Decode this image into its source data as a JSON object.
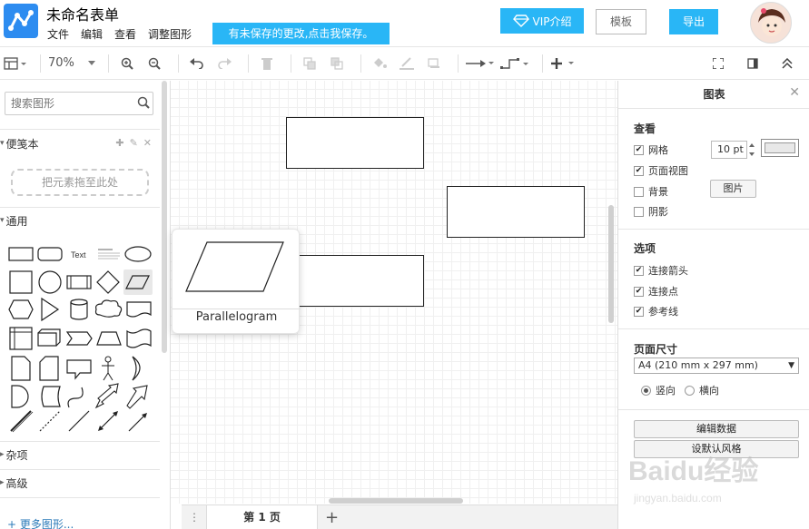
{
  "header": {
    "app_title": "未命名表单",
    "menu": [
      "文件",
      "编辑",
      "查看",
      "调整图形"
    ],
    "unsaved_notice": "有未保存的更改,点击我保存。",
    "vip_label": "VIP介绍",
    "template_label": "模板",
    "export_label": "导出"
  },
  "toolbar": {
    "zoom": "70%"
  },
  "sidebar": {
    "search_placeholder": "搜索图形",
    "scratchpad_title": "便笺本",
    "dropzone_text": "把元素拖至此处",
    "general_title": "通用",
    "misc_title": "杂项",
    "advanced_title": "高级",
    "more_shapes": "+ 更多图形...",
    "shape_text_label": "Text"
  },
  "tooltip": {
    "shape_name": "Parallelogram"
  },
  "pages": {
    "current_tab": "第 1 页"
  },
  "format_panel": {
    "title": "图表",
    "view_section": "查看",
    "grid_label": "网格",
    "grid_size": "10 pt",
    "page_view_label": "页面视图",
    "background_label": "背景",
    "image_button": "图片",
    "shadow_label": "阴影",
    "options_section": "选项",
    "connection_arrows": "连接箭头",
    "connection_points": "连接点",
    "guides": "参考线",
    "paper_size_section": "页面尺寸",
    "paper_size": "A4 (210 mm x 297 mm)",
    "portrait": "竖向",
    "landscape": "横向",
    "edit_data_button": "编辑数据",
    "default_style_button": "默认风格",
    "default_style_prefix": "设"
  },
  "watermark": {
    "text": "Baidu经验",
    "url": "jingyan.baidu.com"
  },
  "colors": {
    "accent": "#29b6f6",
    "logo": "#2d8cf0"
  }
}
